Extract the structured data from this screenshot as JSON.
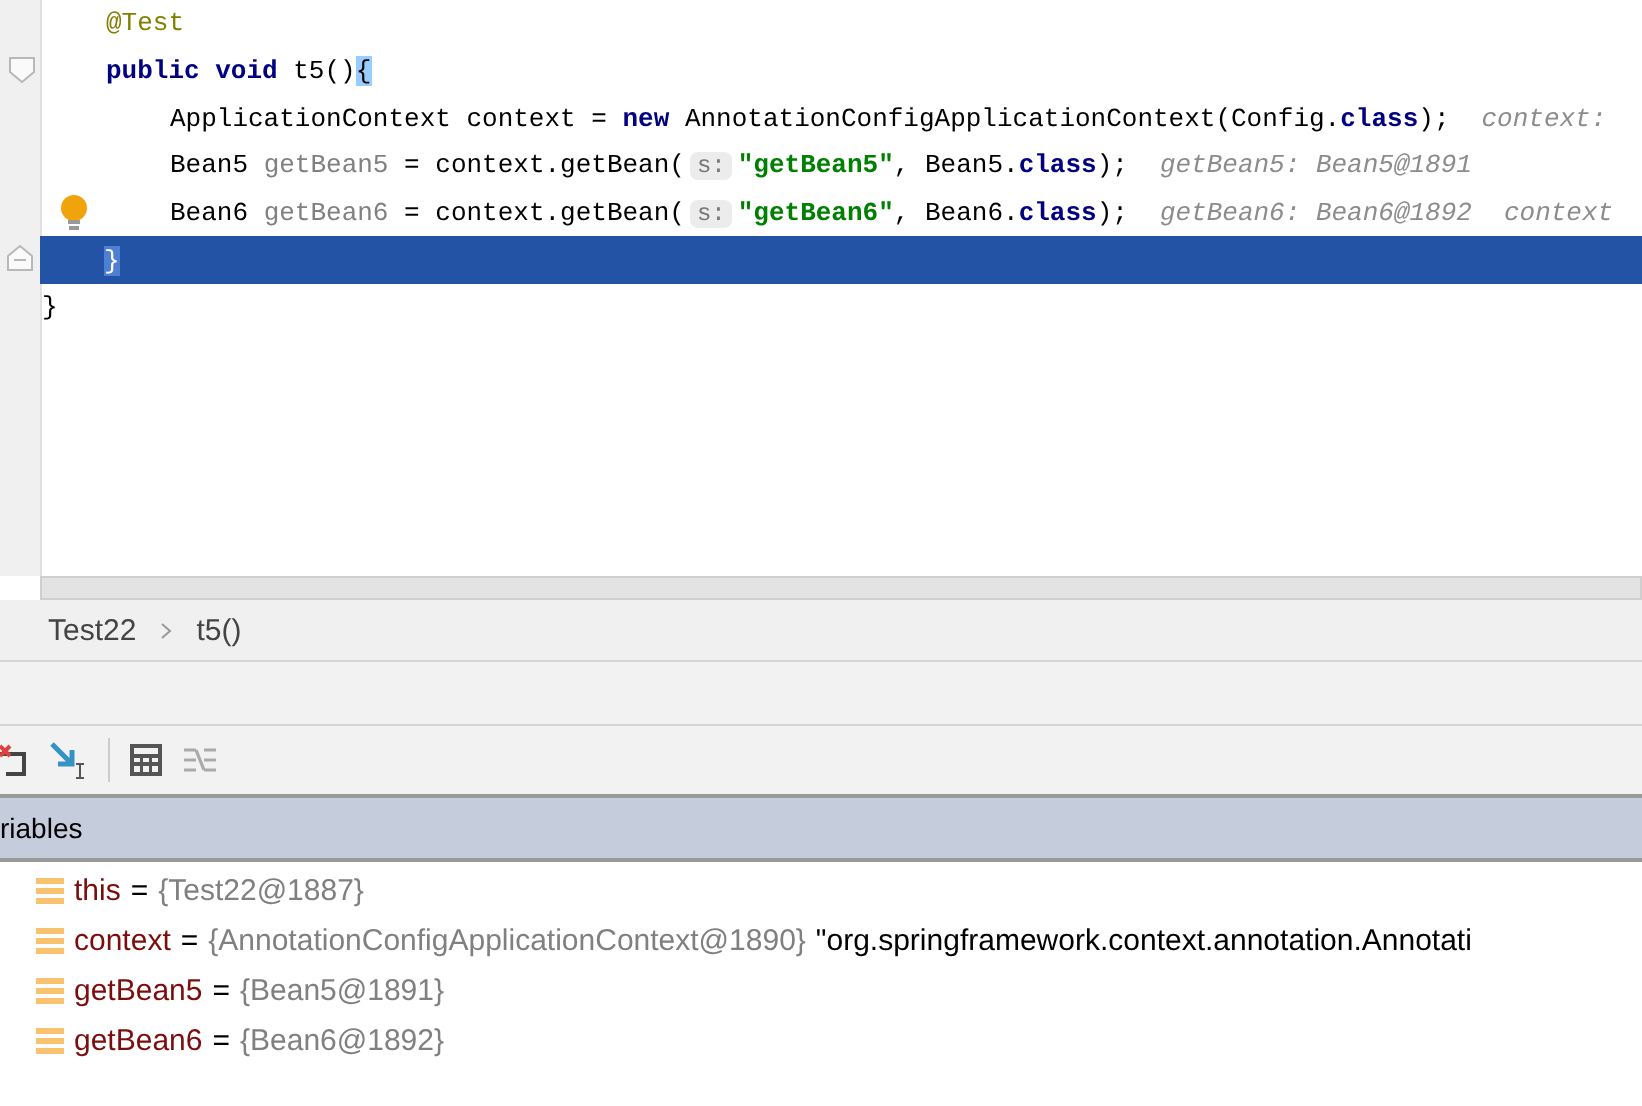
{
  "editor": {
    "class_body": [
      {
        "current": false,
        "bulb": false,
        "fold_marker": false,
        "tokens": [
          {
            "kind": "annotation",
            "text": "@Test"
          }
        ]
      },
      {
        "current": false,
        "bulb": false,
        "fold_marker": true,
        "tokens": [
          {
            "kind": "keyword",
            "text": "public void"
          },
          {
            "kind": "plain",
            "text": " t5()"
          },
          {
            "kind": "brace",
            "text": "{"
          }
        ],
        "children": [
          {
            "current": false,
            "bulb": false,
            "fold_marker": false,
            "tokens": [
              {
                "kind": "plain",
                "text": "ApplicationContext context = "
              },
              {
                "kind": "keyword",
                "text": "new"
              },
              {
                "kind": "plain",
                "text": " AnnotationConfigApplicationContext(Config."
              },
              {
                "kind": "keyword",
                "text": "class"
              },
              {
                "kind": "plain",
                "text": ");"
              },
              {
                "kind": "inlay",
                "text": "context:"
              }
            ]
          },
          {
            "current": false,
            "bulb": false,
            "fold_marker": false,
            "tokens": [
              {
                "kind": "plain",
                "text": "Bean5 "
              },
              {
                "kind": "unused",
                "text": "getBean5"
              },
              {
                "kind": "plain",
                "text": " = context.getBean("
              },
              {
                "kind": "hint",
                "text": "s:"
              },
              {
                "kind": "string",
                "text": "\"getBean5\""
              },
              {
                "kind": "plain",
                "text": ", Bean5."
              },
              {
                "kind": "keyword",
                "text": "class"
              },
              {
                "kind": "plain",
                "text": ");"
              },
              {
                "kind": "inlay",
                "text": "getBean5: Bean5@1891"
              }
            ]
          },
          {
            "current": false,
            "bulb": true,
            "fold_marker": false,
            "tokens": [
              {
                "kind": "plain",
                "text": "Bean6 "
              },
              {
                "kind": "unused",
                "text": "getBean6"
              },
              {
                "kind": "plain",
                "text": " = context.getBean("
              },
              {
                "kind": "hint",
                "text": "s:"
              },
              {
                "kind": "string",
                "text": "\"getBean6\""
              },
              {
                "kind": "plain",
                "text": ", Bean6."
              },
              {
                "kind": "keyword",
                "text": "class"
              },
              {
                "kind": "plain",
                "text": ");"
              },
              {
                "kind": "inlay",
                "text": "getBean6: Bean6@1892"
              },
              {
                "kind": "inlay",
                "text": "context"
              }
            ]
          }
        ]
      },
      {
        "current": true,
        "bulb": false,
        "fold_marker": true,
        "tokens": [
          {
            "kind": "brace",
            "text": "}"
          }
        ]
      }
    ],
    "closing_line": {
      "current": false,
      "bulb": false,
      "fold_marker": false,
      "tokens": [
        {
          "kind": "plain",
          "text": "}"
        }
      ]
    }
  },
  "breadcrumb": [
    "Test22",
    "t5()"
  ],
  "variables_panel": {
    "title": "riables",
    "items": [
      {
        "name": "this",
        "separator": "=",
        "value": "{Test22@1887}"
      },
      {
        "name": "context",
        "separator": "=",
        "value": "{AnnotationConfigApplicationContext@1890}",
        "detail": "\"org.springframework.context.annotation.Annotati"
      },
      {
        "name": "getBean5",
        "separator": "=",
        "value": "{Bean5@1891}"
      },
      {
        "name": "getBean6",
        "separator": "=",
        "value": "{Bean6@1892}"
      }
    ]
  }
}
